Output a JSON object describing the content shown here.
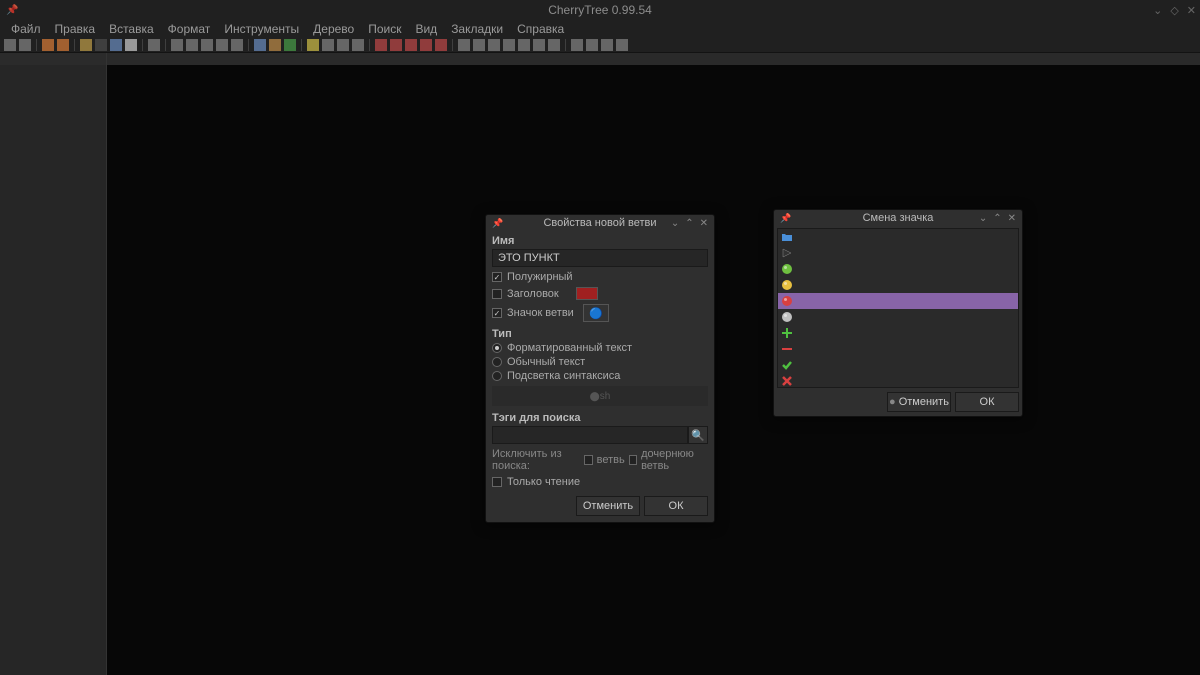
{
  "app": {
    "title": "CherryTree 0.99.54"
  },
  "menu": [
    "Файл",
    "Правка",
    "Вставка",
    "Формат",
    "Инструменты",
    "Дерево",
    "Поиск",
    "Вид",
    "Закладки",
    "Справка"
  ],
  "dlg1": {
    "title": "Свойства новой ветви",
    "name_label": "Имя",
    "name_value": "ЭТО ПУНКТ",
    "bold": "Полужирный",
    "header": "Заголовок",
    "node_icon": "Значок ветви",
    "type_label": "Тип",
    "type_formatted": "Форматированный текст",
    "type_plain": "Обычный текст",
    "type_syntax": "Подсветка синтаксиса",
    "syntax_val": "sh",
    "tags_label": "Тэги для поиска",
    "exclude_label": "Исключить из поиска:",
    "exclude_node": "ветвь",
    "exclude_child": "дочернюю ветвь",
    "readonly": "Только чтение",
    "cancel": "Отменить",
    "ok": "ОК"
  },
  "dlg2": {
    "title": "Смена значка",
    "cancel": "Отменить",
    "ok": "ОК"
  },
  "icons": [
    {
      "name": "folder-blue",
      "color": "#4a8fd8",
      "sel": false,
      "shape": "rect"
    },
    {
      "name": "tag-dark",
      "color": "#333",
      "sel": false,
      "shape": "triangle"
    },
    {
      "name": "circle-green",
      "color": "#6fc040",
      "sel": false,
      "shape": "circle"
    },
    {
      "name": "circle-yellow",
      "color": "#e8c040",
      "sel": false,
      "shape": "circle"
    },
    {
      "name": "circle-red",
      "color": "#d84040",
      "sel": true,
      "shape": "circle"
    },
    {
      "name": "circle-gray",
      "color": "#c0c0c0",
      "sel": false,
      "shape": "circle"
    },
    {
      "name": "plus-green",
      "color": "#4fc040",
      "sel": false,
      "shape": "plus"
    },
    {
      "name": "minus-red",
      "color": "#d84040",
      "sel": false,
      "shape": "minus"
    },
    {
      "name": "check-green",
      "color": "#4fc040",
      "sel": false,
      "shape": "check"
    },
    {
      "name": "cross-red",
      "color": "#d84040",
      "sel": false,
      "shape": "cross"
    },
    {
      "name": "trash",
      "color": "#ddd",
      "sel": false,
      "shape": "trash"
    }
  ]
}
